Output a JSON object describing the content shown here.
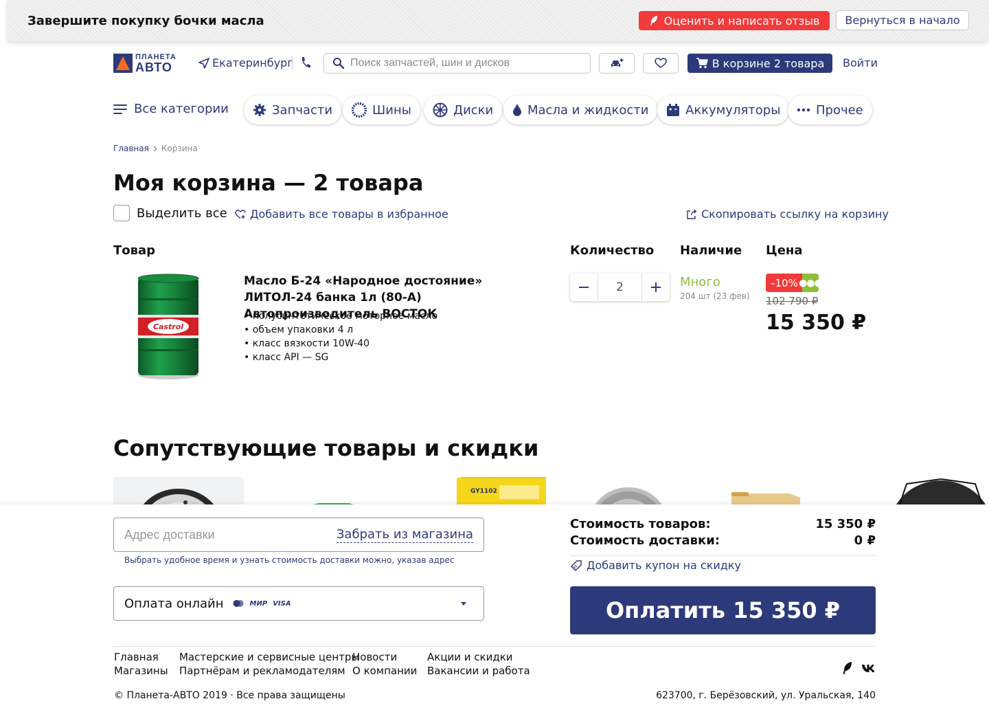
{
  "task_bar": {
    "title": "Завершите покупку бочки масла",
    "review_button": "Оценить и написать отзыв",
    "back_button": "Вернуться в начало"
  },
  "header": {
    "logo_line1": "ПЛАНЕТА",
    "logo_line2": "АВТО",
    "city": "Екатеринбург",
    "search_placeholder": "Поиск запчастей, шин и дисков",
    "cart_button": "В корзине 2 товара",
    "login": "Войти"
  },
  "nav": {
    "all_categories": "Все категории",
    "categories": [
      "Запчасти",
      "Шины",
      "Диски",
      "Масла и жидкости",
      "Аккумуляторы",
      "Прочее"
    ]
  },
  "breadcrumb": [
    "Главная",
    "Корзина"
  ],
  "page_title": "Моя корзина — 2 товара",
  "toolbar": {
    "select_all": "Выделить все",
    "add_all_favorites": "Добавить все товары в избранное",
    "copy_link": "Скопировать ссылку на корзину"
  },
  "columns": {
    "product": "Товар",
    "quantity": "Количество",
    "availability": "Наличие",
    "price": "Цена"
  },
  "item": {
    "name": "Масло Б-24 «Народное достояние» ЛИТОЛ-24 банка 1л (80-А) Автопроизводитель ВОСТОК",
    "image_brand": "Castrol",
    "specs": [
      "• полусинтетическое моторное масло",
      "• объем упаковки 4 л",
      "• класс вязкости 10W-40",
      "• класс API — SG"
    ],
    "quantity": "2",
    "stock": "Много",
    "stock_note": "204 шт (23 фев)",
    "discount": "–10%",
    "old_price": "102 790 ₽",
    "price": "15 350 ₽"
  },
  "related": {
    "title": "Сопутствующие товары и скидки",
    "filter_label": "GY1102"
  },
  "checkout": {
    "address_placeholder": "Адрес доставки",
    "pickup": "Забрать из магазина",
    "address_hint": "Выбрать удобное время и узнать стоимость доставки можно, указав адрес",
    "payment": "Оплата онлайн",
    "payment_logo_mir": "МИР",
    "payment_logo_visa": "VISA",
    "goods_cost_label": "Стоимость товаров:",
    "goods_cost": "15 350 ₽",
    "delivery_cost_label": "Стоимость доставки:",
    "delivery_cost": "0 ₽",
    "coupon": "Добавить купон на скидку",
    "pay_button": "Оплатить 15 350 ₽"
  },
  "footer": {
    "col1": [
      "Главная",
      "Магазины"
    ],
    "col2": [
      "Мастерские и сервисные центры",
      "Партнёрам и рекламодателям"
    ],
    "col3": [
      "Новости",
      "О компании"
    ],
    "col4": [
      "Акции и скидки",
      "Вакансии и работа"
    ],
    "copyright": "© Планета-АВТО 2019 · Все права защищены",
    "address": "623700, г. Берёзовский, ул. Уральская, 140"
  },
  "colors": {
    "brand": "#2d3a7a",
    "accent_red": "#f23a3a",
    "stock_green": "#8dbf3a",
    "logo_orange": "#f26b21"
  }
}
